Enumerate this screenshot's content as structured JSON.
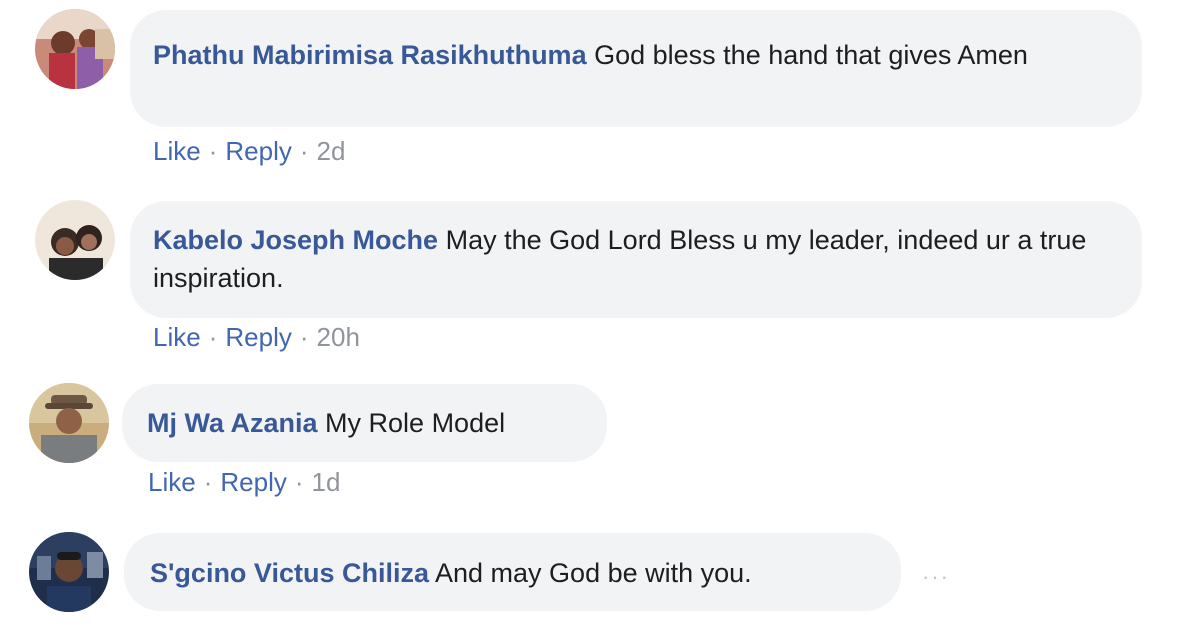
{
  "comments": [
    {
      "author": "Phathu Mabirimisa Rasikhuthuma",
      "text": "God bless the hand that gives Amen",
      "like_label": "Like",
      "reply_label": "Reply",
      "timestamp": "2d",
      "avatar_icon": "profile-photo"
    },
    {
      "author": "Kabelo Joseph Moche",
      "text": "May the God Lord Bless u my leader, indeed ur a true inspiration.",
      "like_label": "Like",
      "reply_label": "Reply",
      "timestamp": "20h",
      "avatar_icon": "profile-photo"
    },
    {
      "author": "Mj Wa Azania",
      "text": "My Role Model",
      "like_label": "Like",
      "reply_label": "Reply",
      "timestamp": "1d",
      "avatar_icon": "profile-photo"
    },
    {
      "author": "S'gcino Victus Chiliza",
      "text": "And may God be with you.",
      "avatar_icon": "profile-photo",
      "more_icon": "more-options-icon",
      "more_label": "···"
    }
  ],
  "colors": {
    "author_link": "#385898",
    "action_link": "#4267b2",
    "bubble_bg": "#f2f3f5",
    "meta_text": "#90949c"
  }
}
